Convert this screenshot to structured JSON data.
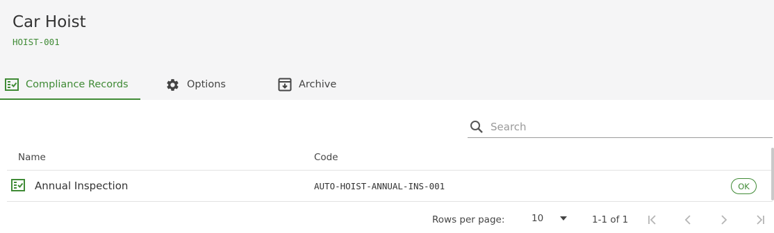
{
  "page": {
    "title": "Car Hoist",
    "code": "HOIST-001"
  },
  "tabs": [
    {
      "label": "Compliance Records",
      "icon": "checklist-icon",
      "active": true
    },
    {
      "label": "Options",
      "icon": "gear-icon",
      "active": false
    },
    {
      "label": "Archive",
      "icon": "archive-icon",
      "active": false
    }
  ],
  "search": {
    "placeholder": "Search",
    "value": ""
  },
  "table": {
    "columns": [
      "Name",
      "Code"
    ],
    "rows": [
      {
        "icon": "checklist-icon",
        "name": "Annual Inspection",
        "code": "AUTO-HOIST-ANNUAL-INS-001",
        "status": "OK"
      }
    ]
  },
  "pagination": {
    "rows_per_page_label": "Rows per page:",
    "rows_per_page": "10",
    "range": "1-1 of 1",
    "first_icon": "first-page-icon",
    "prev_icon": "chevron-left-icon",
    "next_icon": "chevron-right-icon",
    "last_icon": "last-page-icon"
  },
  "colors": {
    "accent": "#3f8a35",
    "header_bg": "#f5f5f6",
    "text": "#333333",
    "muted": "#9a9a9a"
  }
}
